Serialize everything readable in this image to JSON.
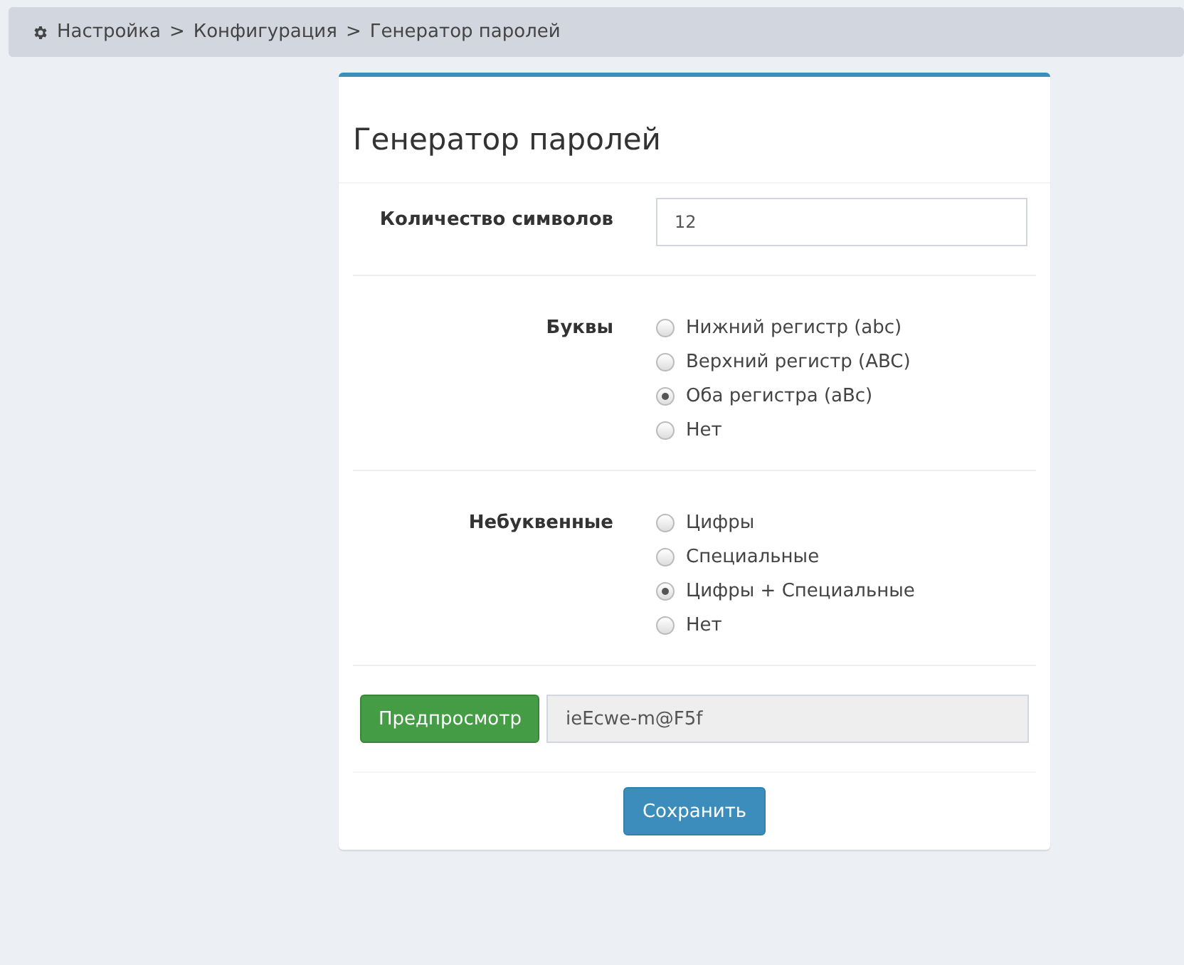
{
  "breadcrumb": [
    {
      "label": "Настройка",
      "separator": ">"
    },
    {
      "label": "Конфигурация",
      "separator": ">"
    },
    {
      "label": "Генератор паролей"
    }
  ],
  "card": {
    "title": "Генератор паролей"
  },
  "length": {
    "label": "Количество символов",
    "value": "12"
  },
  "groups": [
    {
      "label": "Буквы",
      "options": [
        {
          "label": "Нижний регистр (abc)",
          "selected": false
        },
        {
          "label": "Верхний регистр (ABC)",
          "selected": false
        },
        {
          "label": "Оба регистра (aBc)",
          "selected": true
        },
        {
          "label": "Нет",
          "selected": false
        }
      ]
    },
    {
      "label": "Небуквенные",
      "options": [
        {
          "label": "Цифры",
          "selected": false
        },
        {
          "label": "Специальные",
          "selected": false
        },
        {
          "label": "Цифры + Специальные",
          "selected": true
        },
        {
          "label": "Нет",
          "selected": false
        }
      ]
    }
  ],
  "preview": {
    "button": "Предпросмотр",
    "value": "ieEcwe-m@F5f"
  },
  "save_button": "Сохранить"
}
